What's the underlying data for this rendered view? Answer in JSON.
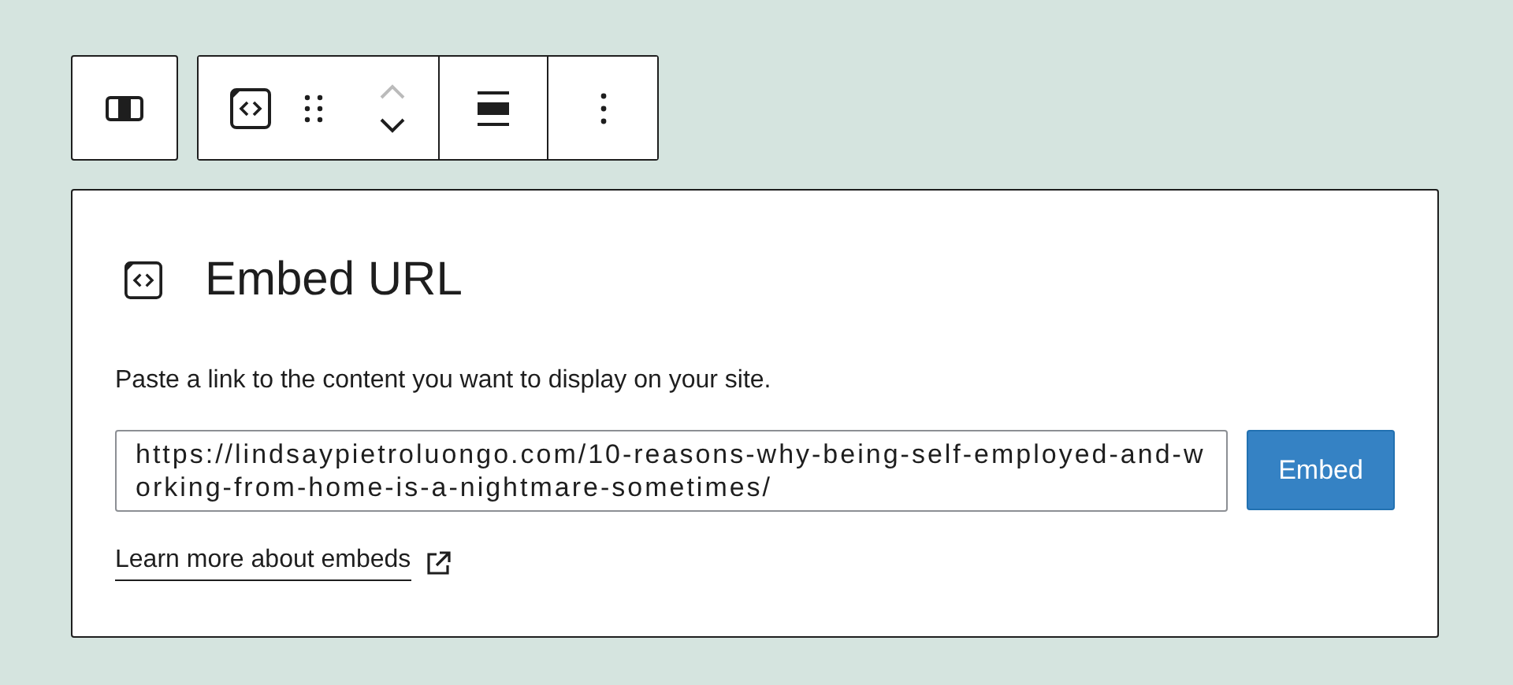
{
  "toolbar": {
    "move_up": {
      "disabled": true
    },
    "move_down": {
      "disabled": false
    }
  },
  "embed": {
    "title": "Embed URL",
    "instructions": "Paste a link to the content you want to display on your site.",
    "url": "https://lindsaypietroluongo.com/10-reasons-why-being-self-employed-and-working-from-home-is-a-nightmare-sometimes/",
    "button": "Embed",
    "help_link": "Learn more about embeds"
  }
}
